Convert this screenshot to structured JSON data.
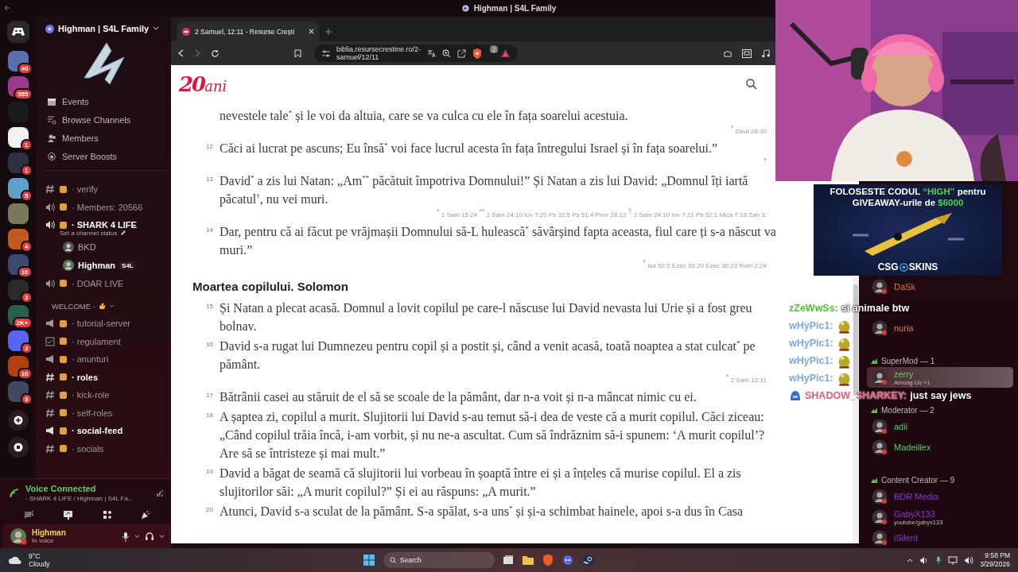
{
  "title_bar": {
    "title": "Highman | S4L Family"
  },
  "servers": [
    {
      "badge": "40",
      "color": "#5a6fb0"
    },
    {
      "badge": "555",
      "color": "#9b3a8a"
    },
    {
      "color": "#1b1b1b"
    },
    {
      "badge": "1",
      "color": "#f2f2f2"
    },
    {
      "badge": "1",
      "color": "#2c3140"
    },
    {
      "badge": "5",
      "color": "#5fa0c8"
    },
    {
      "color": "#7a7a5a"
    },
    {
      "badge": "4",
      "color": "#c05a20"
    },
    {
      "badge": "10",
      "color": "#3a4a70"
    },
    {
      "badge": "2",
      "color": "#2a2a2a"
    },
    {
      "badge": "2K+",
      "color": "#2a5f50"
    },
    {
      "badge": "2",
      "color": "#5865f2"
    },
    {
      "badge": "10",
      "color": "#b04010"
    },
    {
      "badge": "3",
      "color": "#404860"
    }
  ],
  "discord": {
    "server_name": "Highman | S4L Family",
    "menu": [
      "Events",
      "Browse Channels",
      "Members",
      "Server Boosts"
    ],
    "channels": [
      {
        "kind": "text",
        "name": "· verify",
        "unread": false
      },
      {
        "kind": "voice",
        "name": "· Members: 20566",
        "unread": false
      },
      {
        "kind": "voice",
        "name": "· SHARK 4 LIFE",
        "unread": true,
        "status": "Set a channel status",
        "users": [
          {
            "name": "BKD"
          },
          {
            "name": "Highman",
            "tag": "S4L"
          }
        ]
      },
      {
        "kind": "voice",
        "name": "· DOAR LIVE",
        "unread": false
      },
      {
        "kind": "category",
        "name": "WELCOME -"
      },
      {
        "kind": "announcement",
        "name": "· tutorial-server",
        "unread": false
      },
      {
        "kind": "rules",
        "name": "· regulament",
        "unread": false
      },
      {
        "kind": "announcement",
        "name": "· anunturi",
        "unread": false
      },
      {
        "kind": "text",
        "name": "· roles",
        "unread": true
      },
      {
        "kind": "text",
        "name": "· kick-role",
        "unread": false
      },
      {
        "kind": "text",
        "name": "· self-roles",
        "unread": false
      },
      {
        "kind": "announcement",
        "name": "· social-feed",
        "unread": true
      },
      {
        "kind": "text",
        "name": "· socials",
        "unread": false
      }
    ],
    "voice_panel": {
      "status": "Voice Connected",
      "channel": "· SHARK 4 LIFE / Highman | S4L Fa..."
    },
    "user": {
      "name": "Highman",
      "status": "In voice"
    }
  },
  "browser": {
    "tab": {
      "title": "2 Samuel, 12:11 - Resurse Crești",
      "selected": true
    },
    "url": "biblia.resursecrestine.ro/2-samuel/12/11",
    "shield_badge": "2",
    "page": {
      "logo": {
        "number": "20",
        "word": "ani"
      },
      "passage": [
        {
          "kind": "verse",
          "text": "nevestele tale$^{*}$ și le voi da altuia, care se va culca cu ele în fața soarelui acestuia.",
          "refs": "$^{*}$ Deut 28:30"
        },
        {
          "kind": "verse",
          "number": "12",
          "text": "Căci ai lucrat pe ascuns; Eu însă$^{*}$ voi face lucrul acesta în fața întregului Israel și în fața soarelui.”",
          "refs": "$^{*}$"
        },
        {
          "kind": "verse",
          "number": "13",
          "text": "David$^{*}$ a zis lui Natan: „Am$^{**}$ păcătuit împotriva Domnului!” Și Natan a zis lui David: „Domnul îți iartă păcatul$^{†}$, nu vei muri.",
          "refs": "$^{*}$ 1 Sam 15:24 $^{**}$ 2 Sam 24:10 Iov 7:20 Ps 32:5 Ps 51:4 Prov 28:13 $^{†}$ 2 Sam 24:10 Iov 7:21 Ps 32:1 Mica 7:18 Zah 3:"
        },
        {
          "kind": "verse",
          "number": "14",
          "text": "Dar, pentru că ai făcut pe vrăjmașii Domnului să-L hulească$^{*}$ săvârșind fapta aceasta, fiul care ți s-a născut va muri.”",
          "refs": "$^{*}$ Isa 52:5 Ezec 36:20 Ezec 36:23 Rom 2:24"
        },
        {
          "kind": "heading",
          "text": "Moartea copilului. Solomon"
        },
        {
          "kind": "verse",
          "number": "15",
          "text": "Și Natan a plecat acasă. Domnul a lovit copilul pe care-l născuse lui David nevasta lui Urie și a fost greu bolnav."
        },
        {
          "kind": "verse",
          "number": "16",
          "text": "David s-a rugat lui Dumnezeu pentru copil și a postit și, când a venit acasă, toată noaptea a stat culcat$^{*}$ pe pământ.",
          "refs": "$^{*}$ 2 Sam 13:31"
        },
        {
          "kind": "verse",
          "number": "17",
          "text": "Bătrânii casei au stăruit de el să se scoale de la pământ, dar n-a voit și n-a mâncat nimic cu ei."
        },
        {
          "kind": "verse",
          "number": "18",
          "text": "A șaptea zi, copilul a murit. Slujitorii lui David s-au temut să-i dea de veste că a murit copilul. Căci ziceau: „Când copilul trăia încă, i-am vorbit, și nu ne-a ascultat. Cum să îndrăznim să-i spunem: ‘A murit copilul’? Are să se întristeze și mai mult.”"
        },
        {
          "kind": "verse",
          "number": "19",
          "text": "David a băgat de seamă că slujitorii lui vorbeau în șoaptă între ei și a înțeles că murise copilul. El a zis slujitorilor săi: „A murit copilul?” Și ei au răspuns: „A murit.”"
        },
        {
          "kind": "verse",
          "number": "20",
          "text": "Atunci, David s-a sculat de la pământ. S-a spălat, s-a uns$^{*}$ și și-a schimbat hainele, apoi s-a dus în Casa"
        }
      ]
    }
  },
  "ad": {
    "lines": [
      [
        {
          "text": "FOLOSESTE CODUL ",
          "highlight": false
        },
        {
          "text": "“HIGH”",
          "highlight": true
        },
        {
          "text": " pentru",
          "highlight": false
        }
      ],
      [
        {
          "text": "GIVEAWAY-urile de ",
          "highlight": false
        },
        {
          "text": "$6000",
          "highlight": true
        }
      ]
    ],
    "brand_left": "CSG",
    "brand_right": "SKINS"
  },
  "members": [
    {
      "kind": "member",
      "name": "DaSk",
      "color": "#e07a3a",
      "selected": false
    },
    {
      "kind": "spacer"
    },
    {
      "kind": "member",
      "name": "nuria",
      "color": "#e07a3a",
      "selected": false
    },
    {
      "kind": "group",
      "name": "SuperMod — 1"
    },
    {
      "kind": "member",
      "name": "zerry",
      "color": "#4fd36a",
      "activity": "Among Us +1",
      "selected": true
    },
    {
      "kind": "group",
      "name": "Moderator — 2"
    },
    {
      "kind": "member",
      "name": "adii",
      "color": "#4fd36a",
      "selected": false
    },
    {
      "kind": "member",
      "name": "Madeillex",
      "color": "#4fd36a",
      "selected": false
    },
    {
      "kind": "group",
      "name": "Content Creator — 9"
    },
    {
      "kind": "member",
      "name": "BDR Media",
      "color": "#8a3ad0",
      "selected": false
    },
    {
      "kind": "member",
      "name": "GabyX133",
      "color": "#8a3ad0",
      "activity": "youtube/gabyx133",
      "selected": false
    },
    {
      "kind": "member",
      "name": "iSilent",
      "color": "#8a3ad0",
      "selected": false
    }
  ],
  "stream_chat": [
    {
      "kind": "text",
      "user": "zZeWwSs:",
      "color": "#52c234",
      "text": "si animale btw"
    },
    {
      "kind": "emote",
      "user": "wHyPic1:",
      "color": "#7fa7e0"
    },
    {
      "kind": "emote",
      "user": "wHyPic1:",
      "color": "#7fa7e0"
    },
    {
      "kind": "emote",
      "user": "wHyPic1:",
      "color": "#7fa7e0"
    },
    {
      "kind": "emote",
      "user": "wHyPic1:",
      "color": "#7fa7e0"
    },
    {
      "kind": "text",
      "user": "SHADOW_SHARKEY:",
      "color": "#e0607a",
      "text": "just say jews"
    }
  ],
  "taskbar": {
    "temperature": "9°C",
    "weather": "Cloudy",
    "search": "Search",
    "time": "9:58 PM",
    "date": "3/29/2026"
  }
}
